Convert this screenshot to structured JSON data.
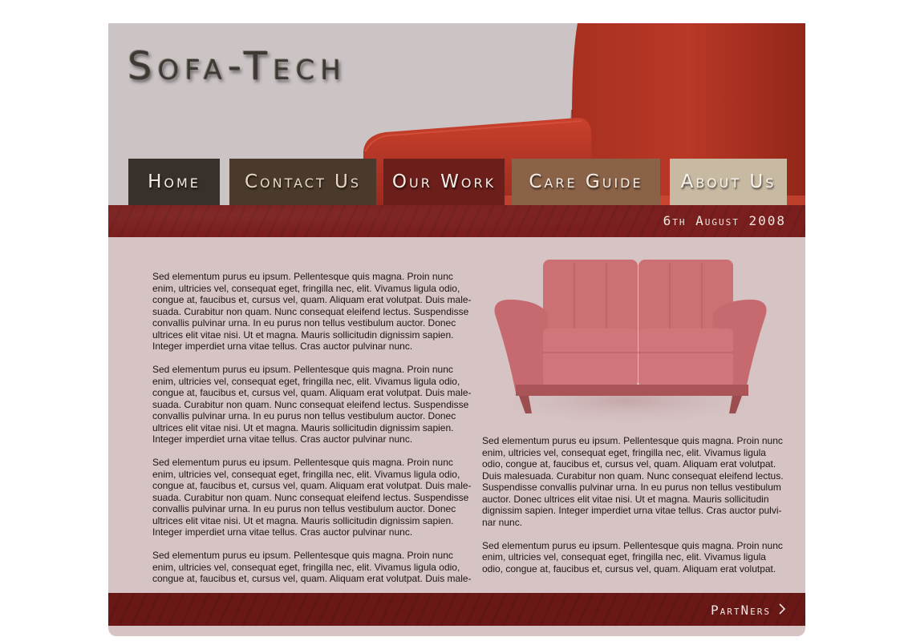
{
  "header": {
    "logo": "Sofa-Tech"
  },
  "nav": {
    "home": "Home",
    "contact": "Contact Us",
    "work": "Our Work",
    "care": "Care Guide",
    "about": "About Us"
  },
  "date": "6th August 2008",
  "content": {
    "left": [
      "Sed elementum purus eu ipsum. Pellentesque quis magna. Proin nunc enim, ultricies vel, consequat eget, fringilla nec, elit. Vivamus ligula odio, congue at, faucibus et, cursus vel, quam. Aliquam erat volutpat. Duis male-suada. Curabitur non quam. Nunc consequat eleifend lectus. Suspendisse convallis pulvinar urna. In eu purus non tellus vestibulum auctor. Donec ultrices elit vitae nisi. Ut et magna. Mauris sollicitudin dignissim sapien. Integer imperdiet urna vitae tellus. Cras auctor pulvinar nunc.",
      "Sed elementum purus eu ipsum. Pellentesque quis magna. Proin nunc enim, ultricies vel, consequat eget, fringilla nec, elit. Vivamus ligula odio, congue at, faucibus et, cursus vel, quam. Aliquam erat volutpat. Duis male-suada. Curabitur non quam. Nunc consequat eleifend lectus. Suspendisse convallis pulvinar urna. In eu purus non tellus vestibulum auctor. Donec ultrices elit vitae nisi. Ut et magna. Mauris sollicitudin dignissim sapien. Integer imperdiet urna vitae tellus. Cras auctor pulvinar nunc.",
      "Sed elementum purus eu ipsum. Pellentesque quis magna. Proin nunc enim, ultricies vel, consequat eget, fringilla nec, elit. Vivamus ligula odio, congue at, faucibus et, cursus vel, quam. Aliquam erat volutpat. Duis male-suada. Curabitur non quam. Nunc consequat eleifend lectus. Suspendisse convallis pulvinar urna. In eu purus non tellus vestibulum auctor. Donec ultrices elit vitae nisi. Ut et magna. Mauris sollicitudin dignissim sapien. Integer imperdiet urna vitae tellus. Cras auctor pulvinar nunc.",
      "Sed elementum purus eu ipsum. Pellentesque quis magna. Proin nunc enim, ultricies vel, consequat eget, fringilla nec, elit. Vivamus ligula odio, congue at, faucibus et, cursus vel, quam. Aliquam erat volutpat. Duis male-"
    ],
    "right": [
      "Sed elementum purus eu ipsum. Pellentesque quis magna. Proin nunc enim, ultricies vel, consequat eget, fringilla nec, elit. Vivamus ligula odio, congue at, faucibus et, cursus vel, quam. Aliquam erat volutpat. Duis malesuada. Curabitur non quam. Nunc consequat eleifend lectus. Suspendisse convallis pulvinar urna. In eu purus non tellus vestibulum auctor. Donec ultrices elit vitae nisi. Ut et magna. Mauris sollicitudin dignissim sapien. Integer imperdiet urna vitae tellus. Cras auctor pulvi-nar nunc.",
      "Sed elementum purus eu ipsum. Pellentesque quis magna. Proin nunc enim, ultricies vel, consequat eget, fringilla nec, elit. Vivamus ligula odio, congue at, faucibus et, cursus vel, quam. Aliquam erat volutpat."
    ]
  },
  "footer": {
    "partners": "PartNers",
    "arrow_icon": "chevron-right-icon"
  },
  "colors": {
    "brand_red": "#7a1f1e",
    "page_bg": "#d6c3c4",
    "header_bg": "#ccc4c4"
  }
}
